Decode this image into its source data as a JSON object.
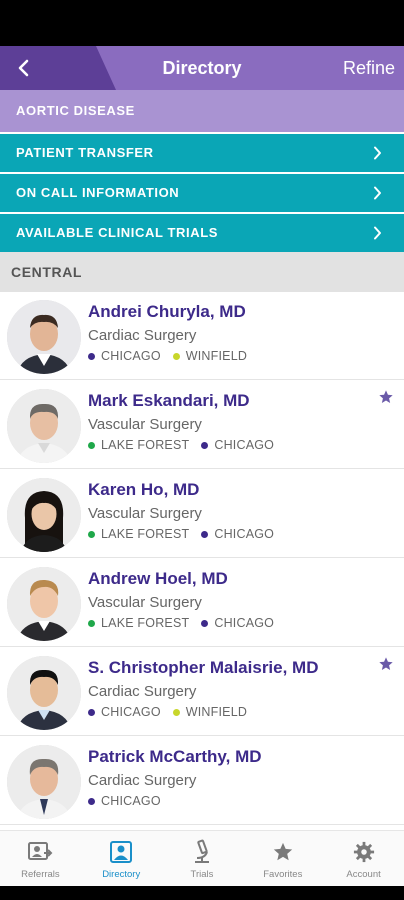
{
  "header": {
    "back_icon": "chevron-left-icon",
    "title": "Directory",
    "refine_label": "Refine"
  },
  "category": "AORTIC DISEASE",
  "menu": [
    {
      "label": "PATIENT TRANSFER",
      "icon": "chevron-right-icon"
    },
    {
      "label": "ON CALL INFORMATION",
      "icon": "chevron-right-icon"
    },
    {
      "label": "AVAILABLE CLINICAL TRIALS",
      "icon": "chevron-right-icon"
    }
  ],
  "section_title": "CENTRAL",
  "colors": {
    "chicago": "#3d2a8a",
    "winfield": "#c8d62b",
    "lake_forest": "#1fa84a",
    "star": "#6a5aa8",
    "teal": "#0aa6b6",
    "purple": "#8a6cbf"
  },
  "doctors": [
    {
      "name": "Andrei Churyla, MD",
      "specialty": "Cardiac Surgery",
      "favorite": false,
      "locations": [
        {
          "label": "CHICAGO",
          "color": "#3d2a8a"
        },
        {
          "label": "WINFIELD",
          "color": "#c8d62b"
        }
      ]
    },
    {
      "name": "Mark Eskandari, MD",
      "specialty": "Vascular Surgery",
      "favorite": true,
      "locations": [
        {
          "label": "LAKE FOREST",
          "color": "#1fa84a"
        },
        {
          "label": "CHICAGO",
          "color": "#3d2a8a"
        }
      ]
    },
    {
      "name": "Karen Ho, MD",
      "specialty": "Vascular Surgery",
      "favorite": false,
      "locations": [
        {
          "label": "LAKE FOREST",
          "color": "#1fa84a"
        },
        {
          "label": "CHICAGO",
          "color": "#3d2a8a"
        }
      ]
    },
    {
      "name": "Andrew Hoel, MD",
      "specialty": "Vascular Surgery",
      "favorite": false,
      "locations": [
        {
          "label": "LAKE FOREST",
          "color": "#1fa84a"
        },
        {
          "label": "CHICAGO",
          "color": "#3d2a8a"
        }
      ]
    },
    {
      "name": "S. Christopher Malaisrie, MD",
      "specialty": "Cardiac Surgery",
      "favorite": true,
      "locations": [
        {
          "label": "CHICAGO",
          "color": "#3d2a8a"
        },
        {
          "label": "WINFIELD",
          "color": "#c8d62b"
        }
      ]
    },
    {
      "name": "Patrick McCarthy, MD",
      "specialty": "Cardiac Surgery",
      "favorite": false,
      "locations": [
        {
          "label": "CHICAGO",
          "color": "#3d2a8a"
        }
      ]
    }
  ],
  "tabs": [
    {
      "label": "Referrals",
      "icon": "referral-icon",
      "active": false
    },
    {
      "label": "Directory",
      "icon": "directory-icon",
      "active": true
    },
    {
      "label": "Trials",
      "icon": "microscope-icon",
      "active": false
    },
    {
      "label": "Favorites",
      "icon": "star-icon",
      "active": false
    },
    {
      "label": "Account",
      "icon": "gear-icon",
      "active": false
    }
  ]
}
